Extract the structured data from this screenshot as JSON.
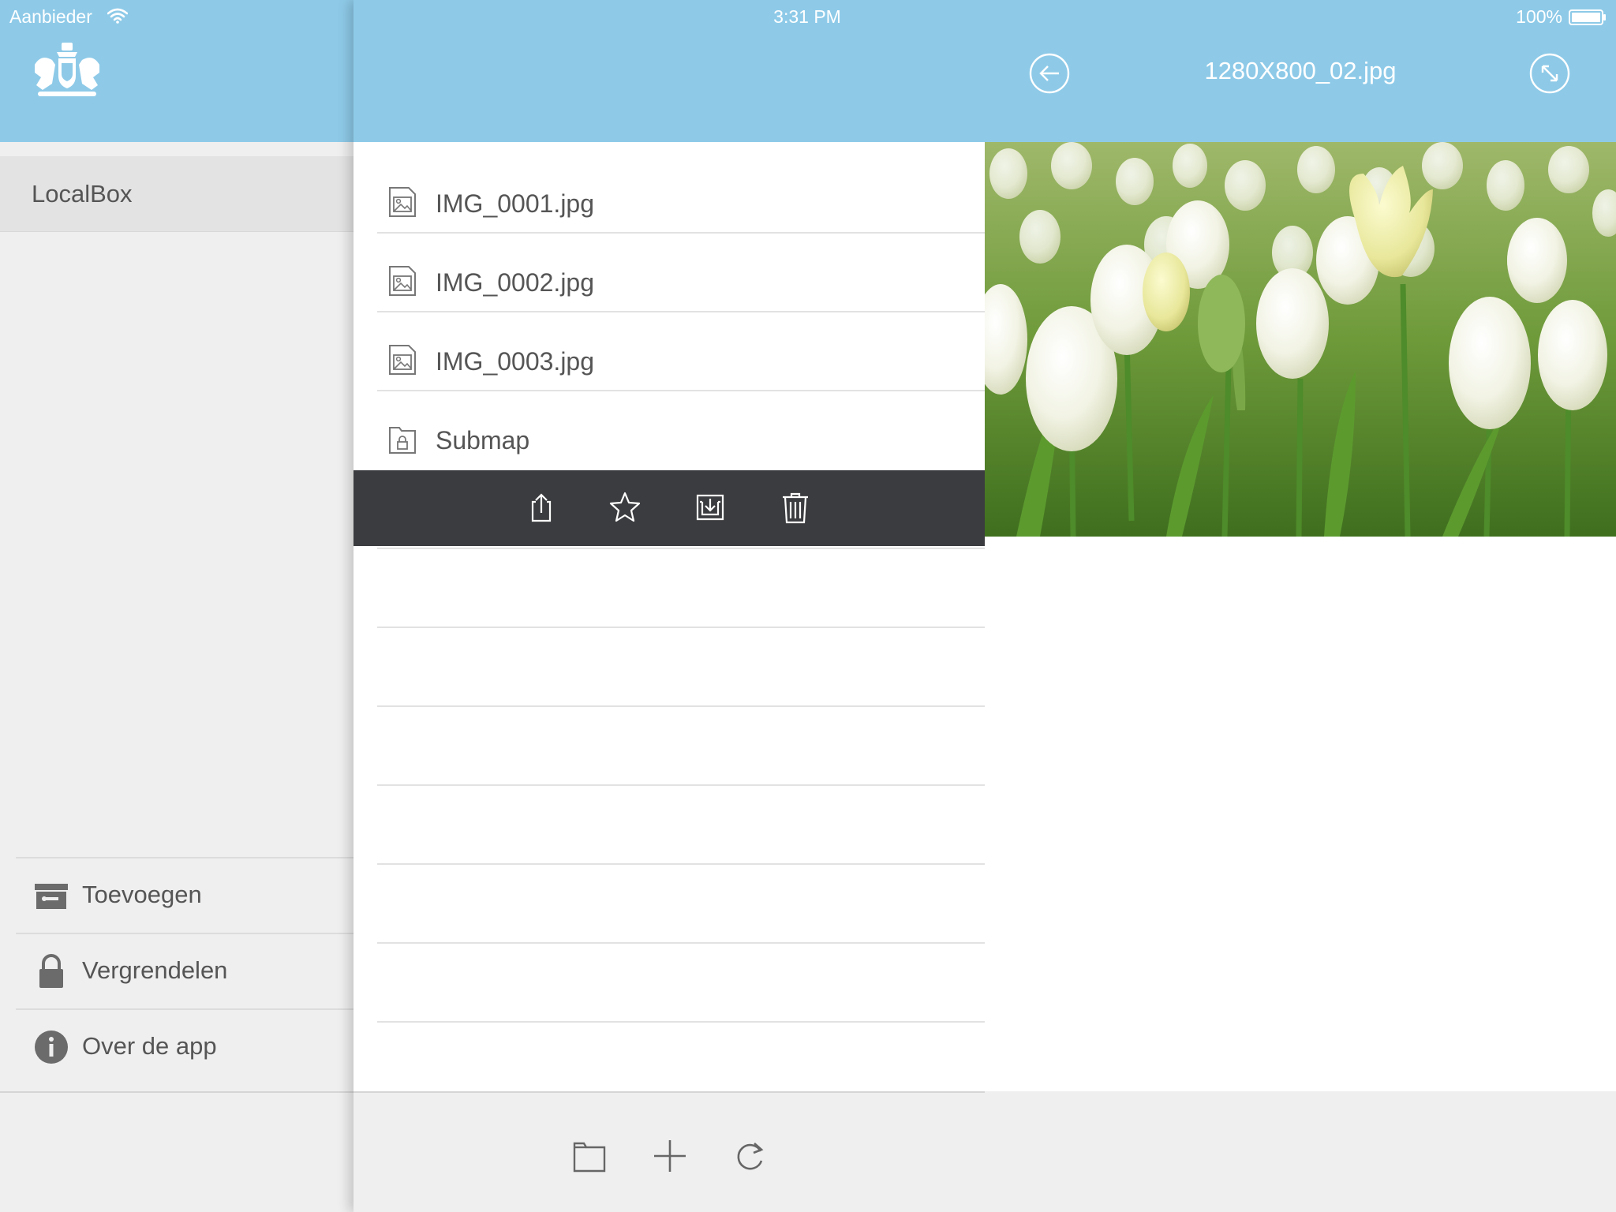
{
  "status_bar": {
    "carrier": "Aanbieder",
    "time": "3:31 PM",
    "battery": "100%"
  },
  "sidebar": {
    "logo_icon": "coat-of-arms-icon",
    "selected_item": "LocalBox",
    "actions": [
      {
        "label": "Toevoegen",
        "icon": "add-box-icon"
      },
      {
        "label": "Vergrendelen",
        "icon": "lock-icon"
      },
      {
        "label": "Over de app",
        "icon": "info-icon"
      }
    ]
  },
  "file_list": {
    "items": [
      {
        "name": "IMG_0001.jpg",
        "icon": "image-file-icon"
      },
      {
        "name": "IMG_0002.jpg",
        "icon": "image-file-icon"
      },
      {
        "name": "IMG_0003.jpg",
        "icon": "image-file-icon"
      },
      {
        "name": "Submap",
        "icon": "locked-folder-icon"
      }
    ],
    "row_actions": [
      "share-icon",
      "star-icon",
      "save-icon",
      "trash-icon"
    ],
    "footer_actions": [
      "folder-icon",
      "plus-icon",
      "refresh-icon"
    ]
  },
  "preview": {
    "title": "1280X800_02.jpg",
    "back_icon": "back-arrow-icon",
    "expand_icon": "expand-icon",
    "image": "white tulips photo"
  },
  "colors": {
    "header": "#8ecae8",
    "sidebar_bg": "#efefef",
    "selected_bg": "#e3e3e3",
    "action_bar": "#3b3c3f",
    "text": "#555555"
  }
}
